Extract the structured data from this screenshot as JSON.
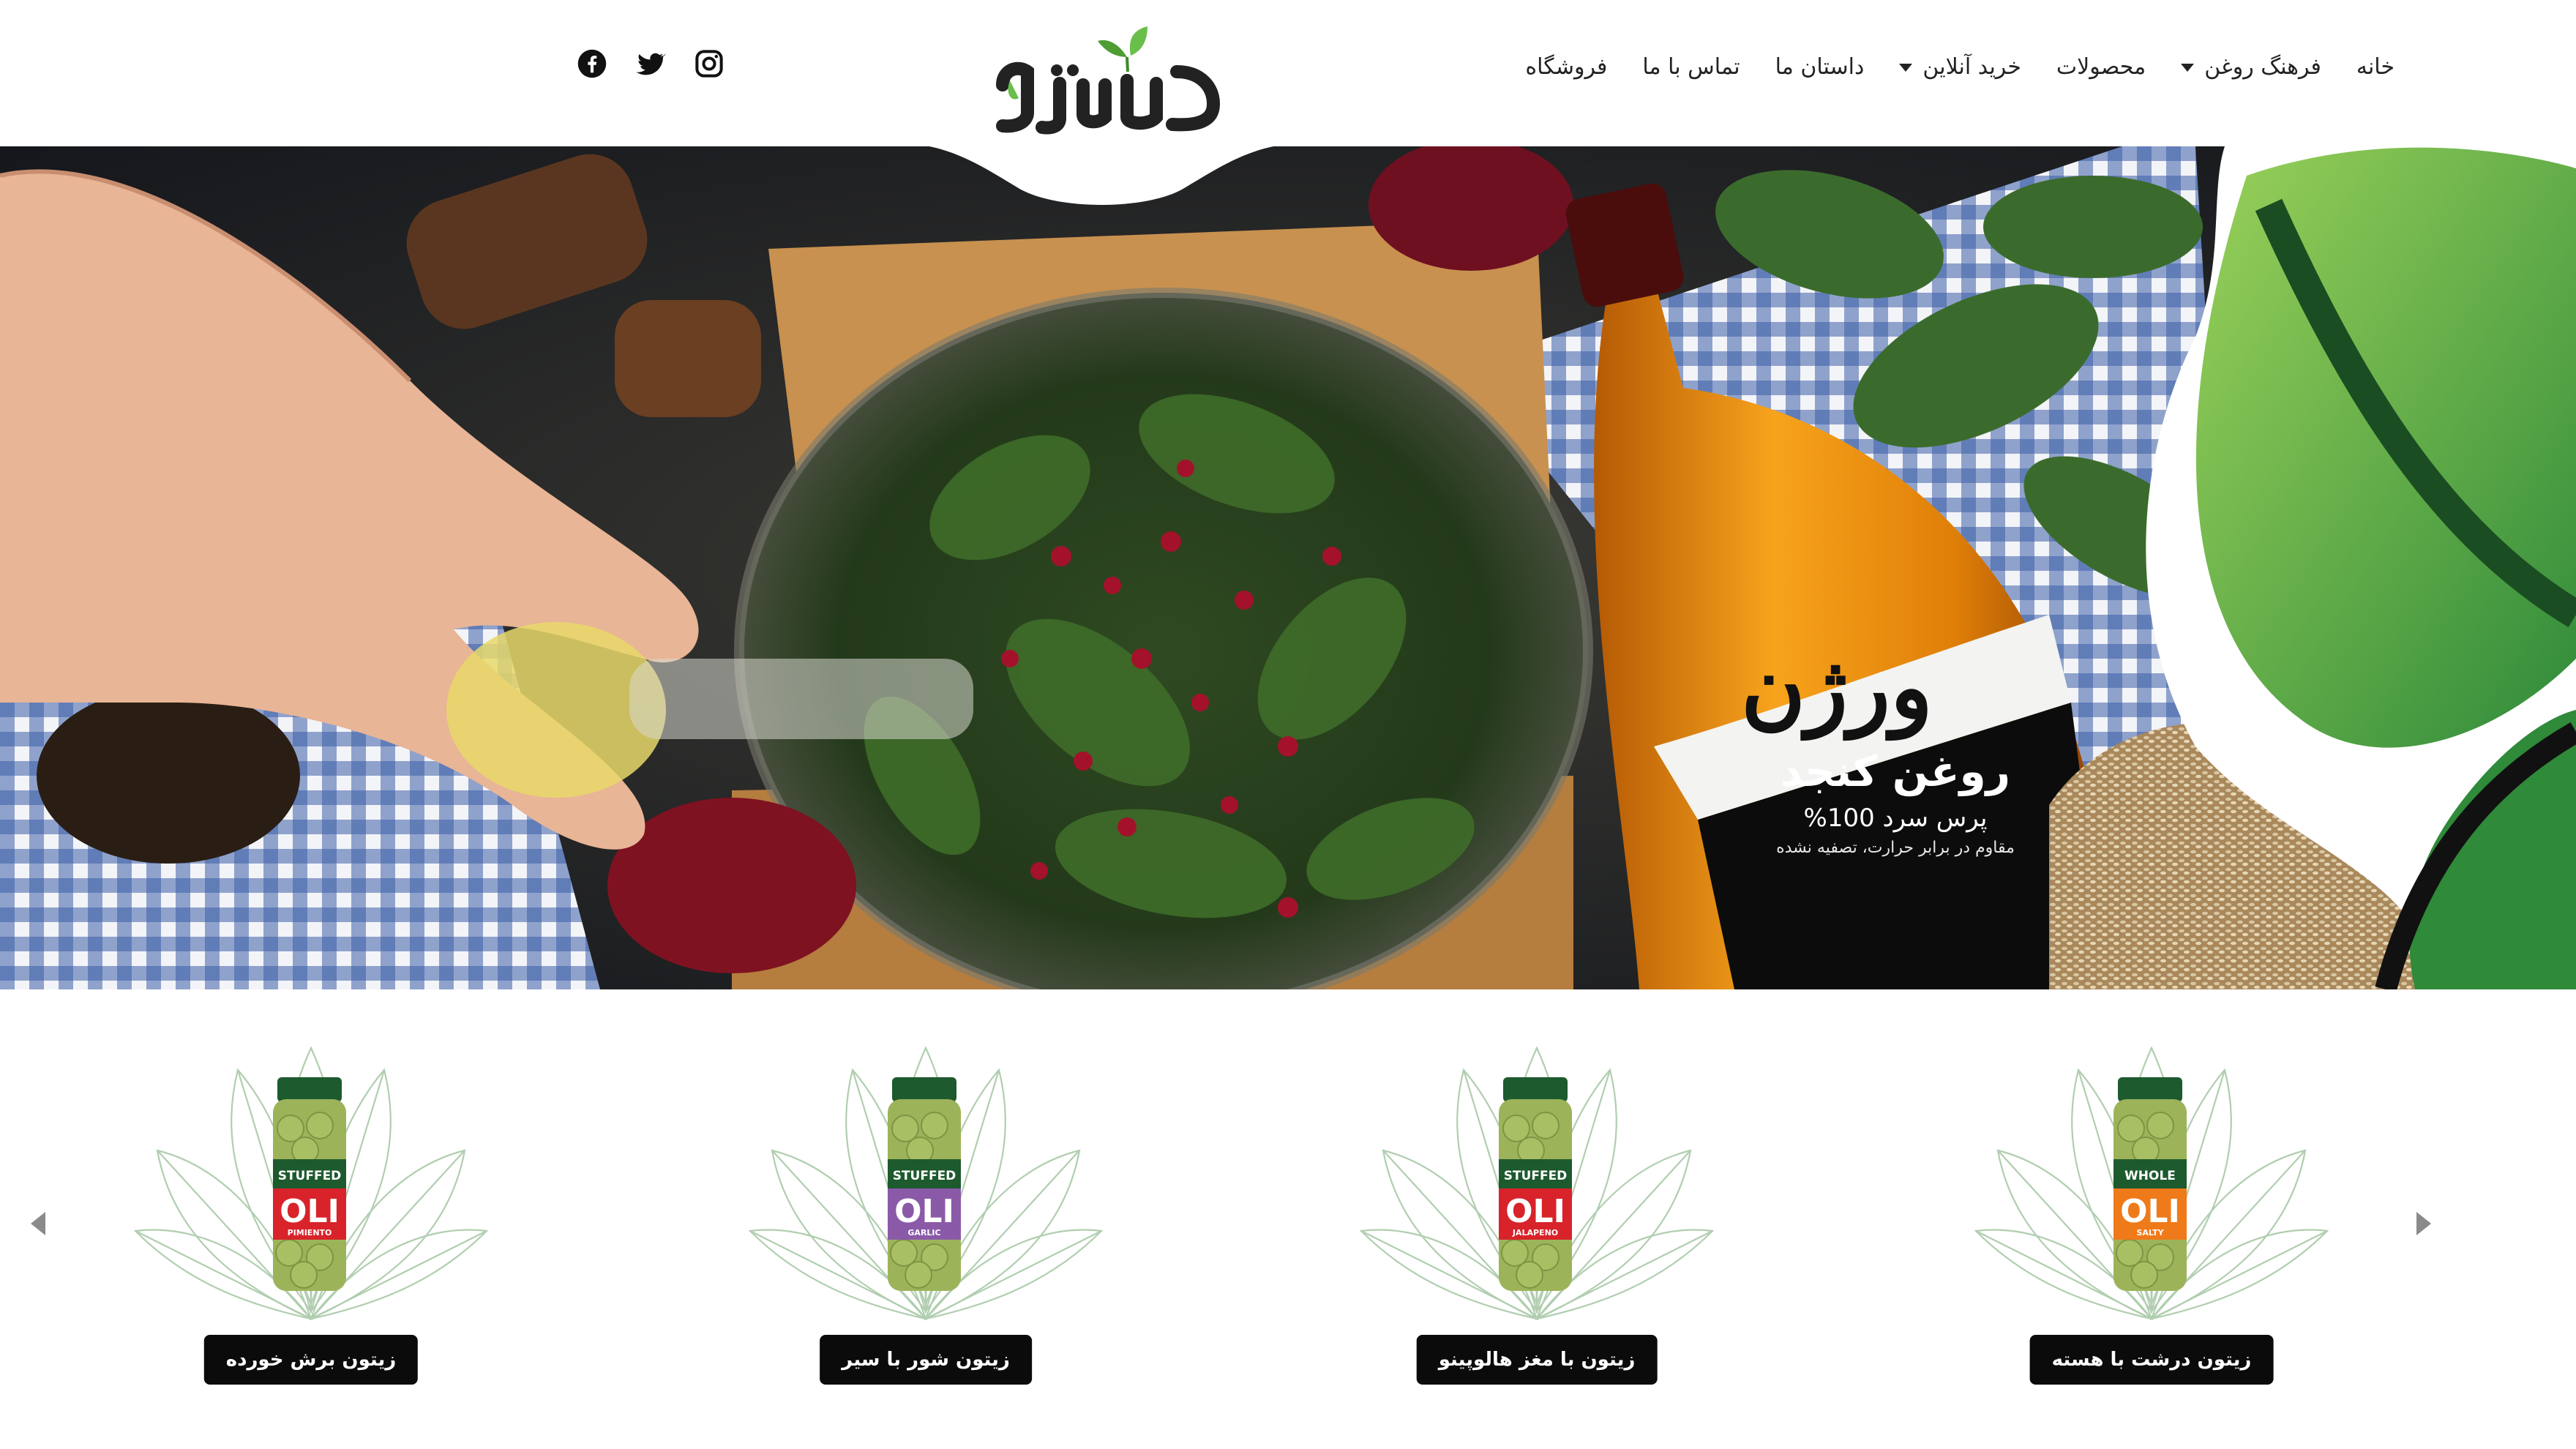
{
  "header": {
    "nav": [
      {
        "label": "خانه",
        "dropdown": false
      },
      {
        "label": "فرهنگ روغن",
        "dropdown": true
      },
      {
        "label": "محصولات",
        "dropdown": false
      },
      {
        "label": "خرید آنلاین",
        "dropdown": true
      },
      {
        "label": "داستان ما",
        "dropdown": false
      },
      {
        "label": "تماس با ما",
        "dropdown": false
      },
      {
        "label": "فروشگاه",
        "dropdown": false
      }
    ],
    "social": [
      "facebook-icon",
      "twitter-icon",
      "instagram-icon"
    ],
    "logo": {
      "text": "ورژن"
    }
  },
  "hero": {
    "bottle": {
      "brand": "ورژن",
      "name": "روغن کنجد",
      "sub": "پرس سرد 100%",
      "desc": "مقاوم در برابر حرارت، تصفیه نشده"
    }
  },
  "products": [
    {
      "title": "زیتون درشت با هسته",
      "jar_text": "WHOLE",
      "jar_variant": "SALTY",
      "accent": "#ef7a1a"
    },
    {
      "title": "زیتون با مغز هالوپینو",
      "jar_text": "STUFFED",
      "jar_variant": "JALAPENO",
      "accent": "#d8232a"
    },
    {
      "title": "زیتون شور با سیر",
      "jar_text": "STUFFED",
      "jar_variant": "GARLIC",
      "accent": "#8a5aa8"
    },
    {
      "title": "زیتون  برش خورده",
      "jar_text": "STUFFED",
      "jar_variant": "PIMIENTO",
      "accent": "#d8232a"
    }
  ],
  "colors": {
    "brand_green": "#6abf4b",
    "dark": "#111111",
    "tag_bg": "#0b0b0b"
  }
}
